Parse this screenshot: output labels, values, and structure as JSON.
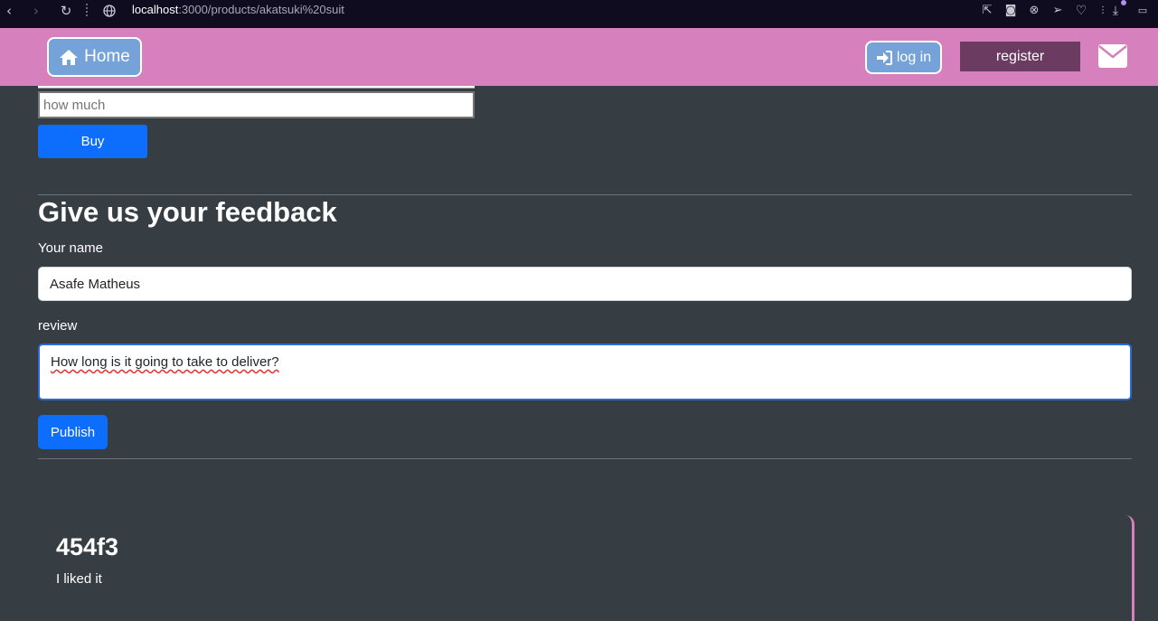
{
  "browser": {
    "url_host": "localhost",
    "url_path": ":3000/products/akatsuki%20suit"
  },
  "navbar": {
    "home_label": "Home",
    "login_label": "log in",
    "register_label": "register",
    "colors": {
      "bar": "#d681bd",
      "button": "#74a2d9",
      "register": "#6b3b61"
    }
  },
  "purchase": {
    "quantity_placeholder": "how much",
    "buy_label": "Buy"
  },
  "feedback": {
    "title": "Give us your feedback",
    "name_label": "Your name",
    "name_value": "Asafe Matheus",
    "review_label": "review",
    "review_value": "How long is it going to take to deliver?",
    "publish_label": "Publish"
  },
  "reviews": [
    {
      "author": "454f3",
      "text": "I liked it"
    }
  ]
}
